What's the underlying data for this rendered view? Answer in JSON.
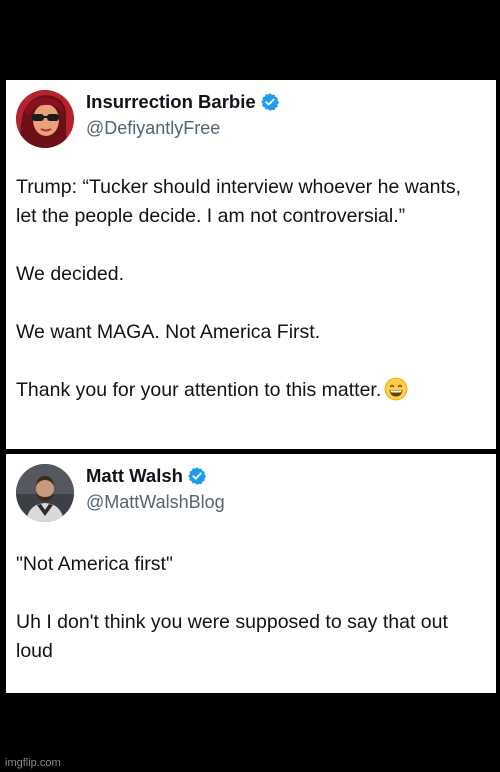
{
  "tweets": [
    {
      "display_name": "Insurrection Barbie",
      "handle": "@DefiyantlyFree",
      "verified": true,
      "avatar_icon": "profile-photo-woman-sunglasses",
      "paragraphs": [
        "Trump: “Tucker should interview whoever he wants, let the people decide. I am not controversial.”",
        "We decided.",
        "We want MAGA. Not America First.",
        "Thank you for your attention to this matter."
      ],
      "emoji": "grinning-face-with-smiling-eyes"
    },
    {
      "display_name": "Matt Walsh",
      "handle": "@MattWalshBlog",
      "verified": true,
      "avatar_icon": "profile-photo-man-beard",
      "paragraphs": [
        "\"Not America first\"",
        "Uh I don't think you were supposed to say that out loud"
      ]
    }
  ],
  "watermark": "imgflip.com",
  "colors": {
    "background": "#000000",
    "card": "#ffffff",
    "text": "#0f1419",
    "handle": "#536471",
    "verified": "#1d9bf0"
  }
}
